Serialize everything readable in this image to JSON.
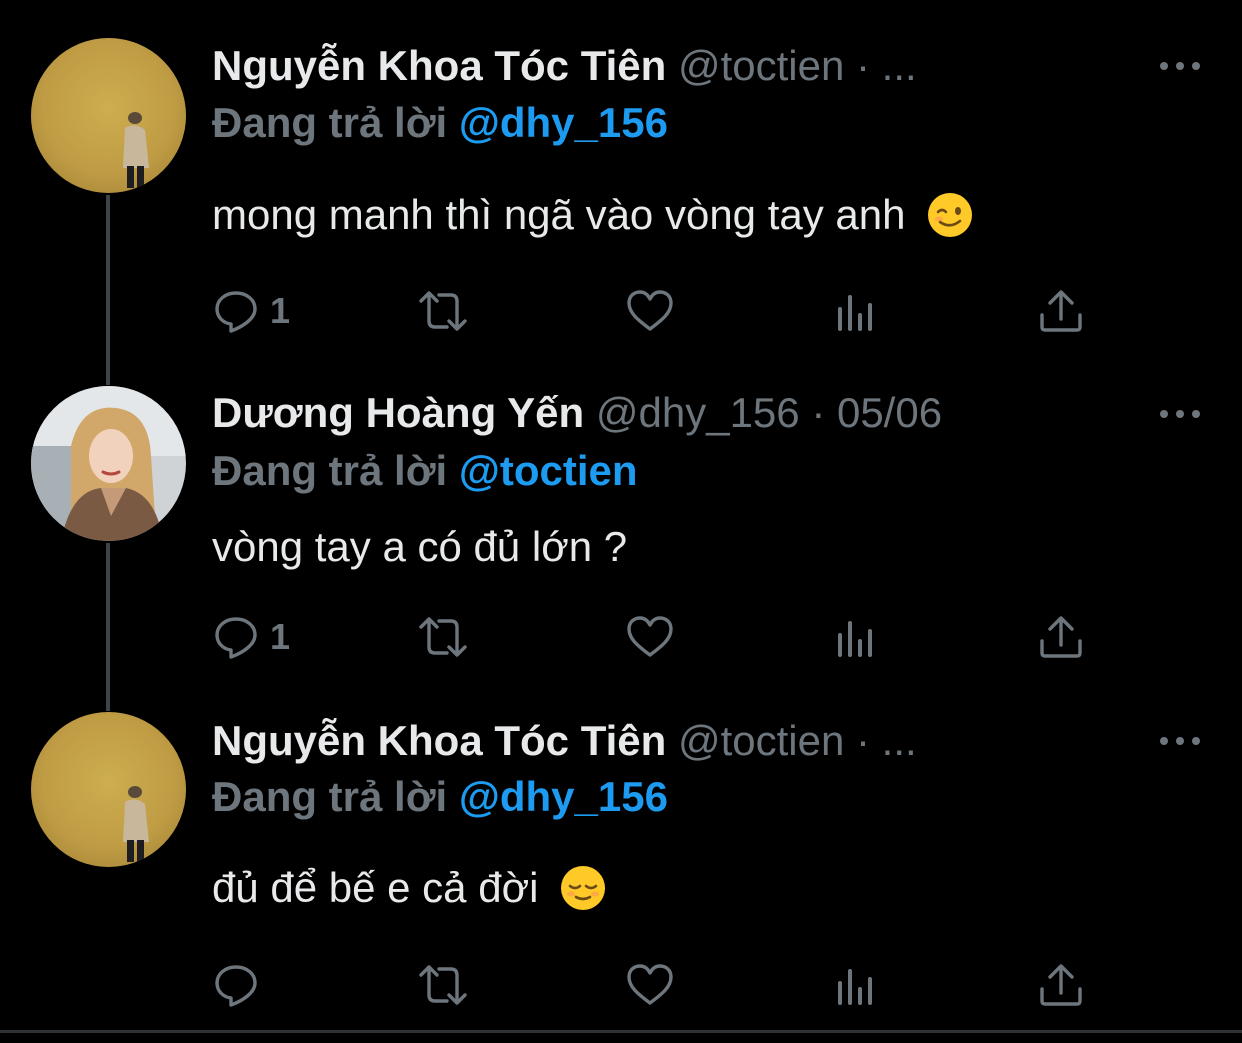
{
  "colors": {
    "background": "#000000",
    "text_primary": "#e7e9ea",
    "text_secondary": "#6e767d",
    "accent": "#1d9bf0",
    "thread_line": "#3d4348"
  },
  "tweets": [
    {
      "author_name": "Nguyễn Khoa Tóc Tiên",
      "meta": "@toctien · ...",
      "reply_prefix": "Đang trả lời",
      "reply_handle": "@dhy_156",
      "text": "mong manh thì ngã vào vòng tay anh",
      "emoji": "winking-face",
      "reply_count": "1",
      "icons": [
        "reply-icon",
        "retweet-icon",
        "like-icon",
        "analytics-icon",
        "share-icon"
      ]
    },
    {
      "author_name": "Dương Hoàng Yến",
      "meta": "@dhy_156 · 05/06",
      "reply_prefix": "Đang trả lời",
      "reply_handle": "@toctien",
      "text": "vòng tay a có đủ lớn ?",
      "emoji": "",
      "reply_count": "1",
      "icons": [
        "reply-icon",
        "retweet-icon",
        "like-icon",
        "analytics-icon",
        "share-icon"
      ]
    },
    {
      "author_name": "Nguyễn Khoa Tóc Tiên",
      "meta": "@toctien · ...",
      "reply_prefix": "Đang trả lời",
      "reply_handle": "@dhy_156",
      "text": "đủ để bế e cả đời",
      "emoji": "relieved-face",
      "reply_count": "",
      "icons": [
        "reply-icon",
        "retweet-icon",
        "like-icon",
        "analytics-icon",
        "share-icon"
      ]
    }
  ]
}
